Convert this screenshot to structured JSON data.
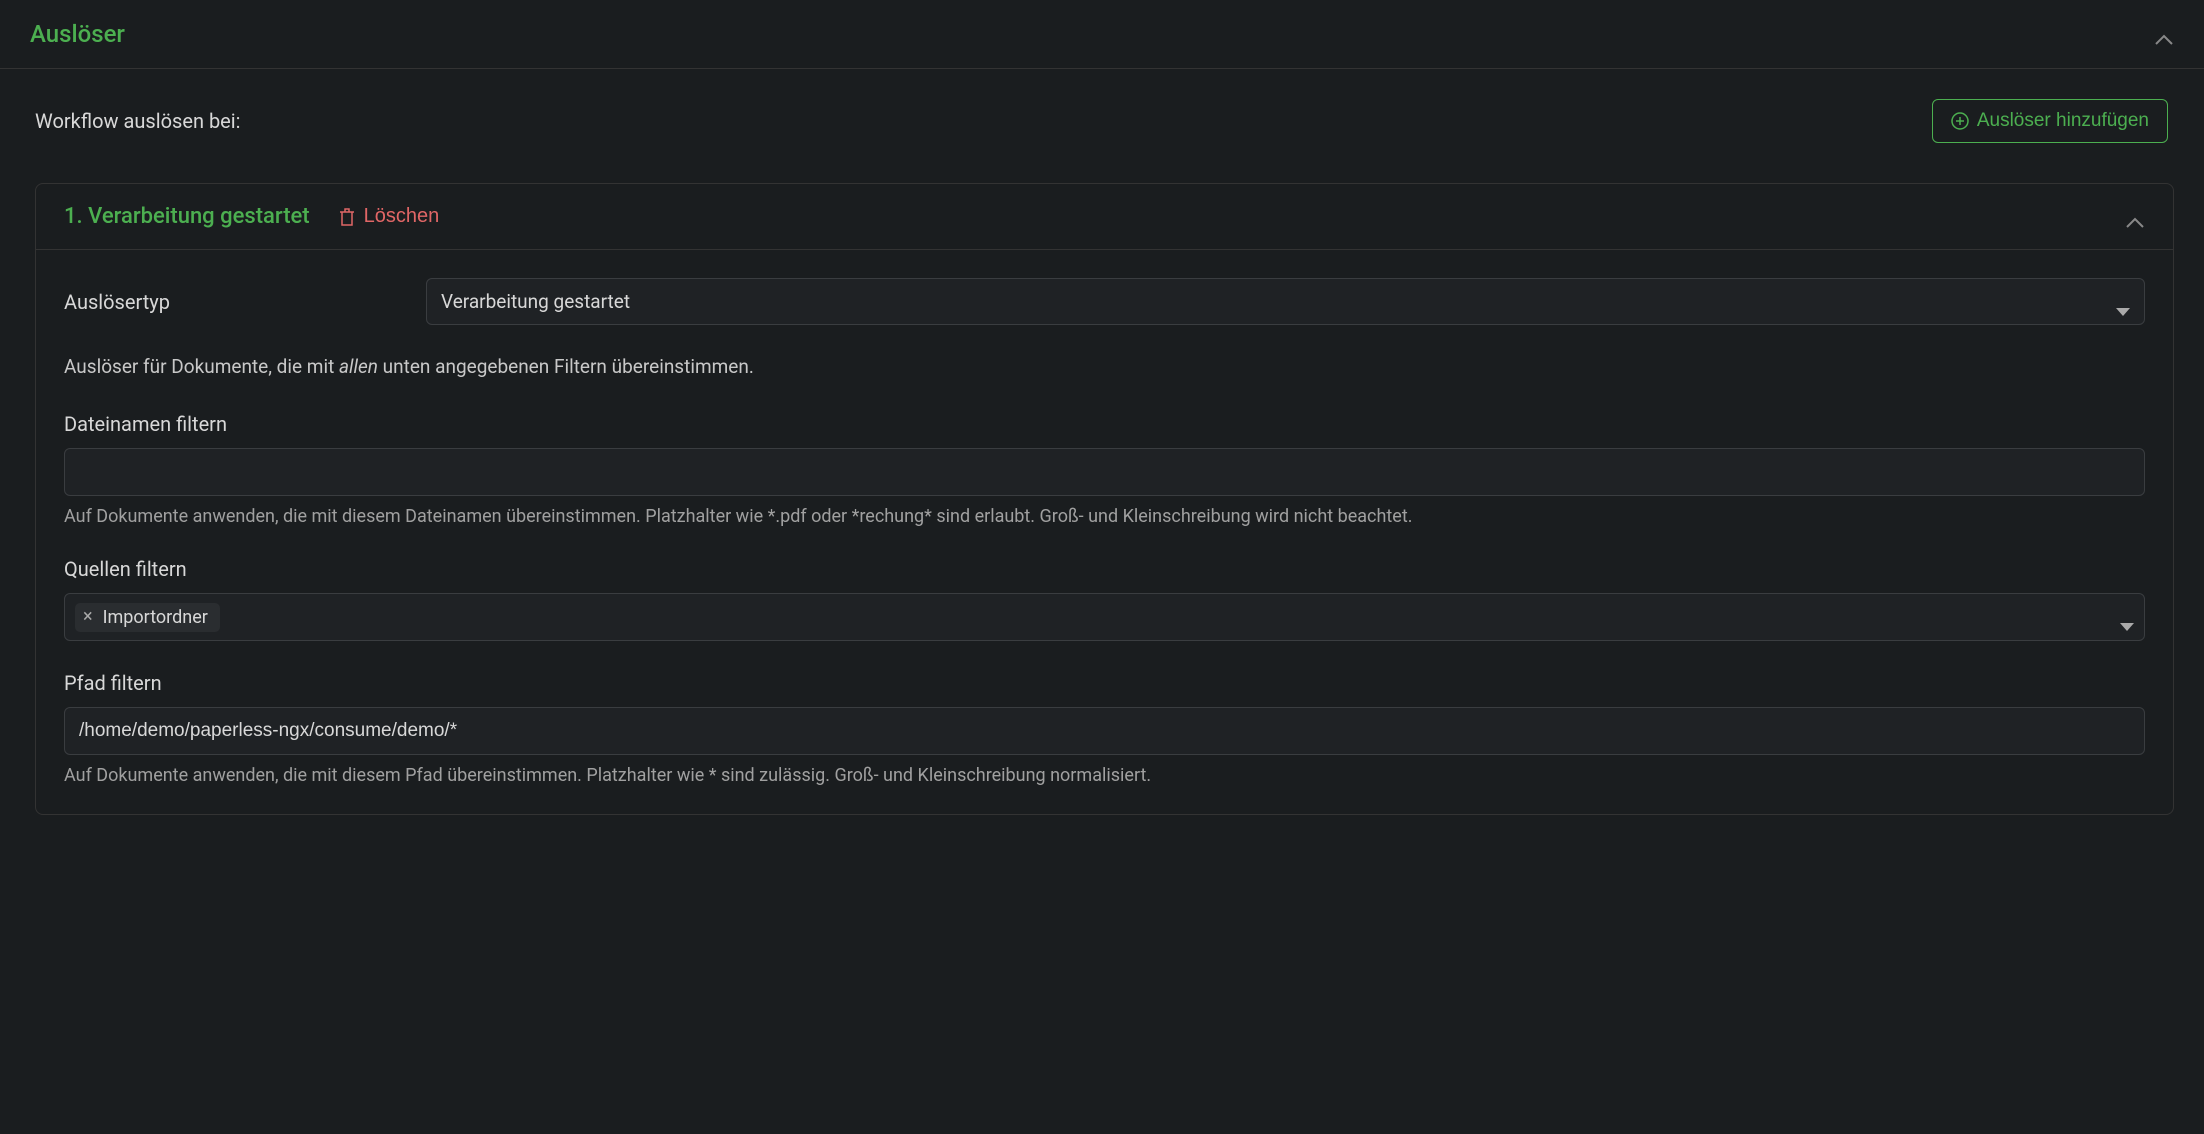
{
  "panel": {
    "title": "Auslöser"
  },
  "toolbar": {
    "label": "Workflow auslösen bei:",
    "add_button": "Auslöser hinzufügen"
  },
  "trigger": {
    "title": "1. Verarbeitung gestartet",
    "delete_label": "Löschen",
    "type_label": "Auslösertyp",
    "type_value": "Verarbeitung gestartet",
    "help_prefix": "Auslöser für Dokumente, die mit ",
    "help_italic": "allen",
    "help_suffix": " unten angegebenen Filtern übereinstimmen.",
    "filename": {
      "label": "Dateinamen filtern",
      "value": "",
      "hint": "Auf Dokumente anwenden, die mit diesem Dateinamen übereinstimmen. Platzhalter wie *.pdf oder *rechung* sind erlaubt. Groß- und Kleinschreibung wird nicht beachtet."
    },
    "sources": {
      "label": "Quellen filtern",
      "chip": "Importordner"
    },
    "path": {
      "label": "Pfad filtern",
      "value": "/home/demo/paperless-ngx/consume/demo/*",
      "hint": "Auf Dokumente anwenden, die mit diesem Pfad übereinstimmen. Platzhalter wie * sind zulässig. Groß- und Kleinschreibung normalisiert."
    }
  }
}
